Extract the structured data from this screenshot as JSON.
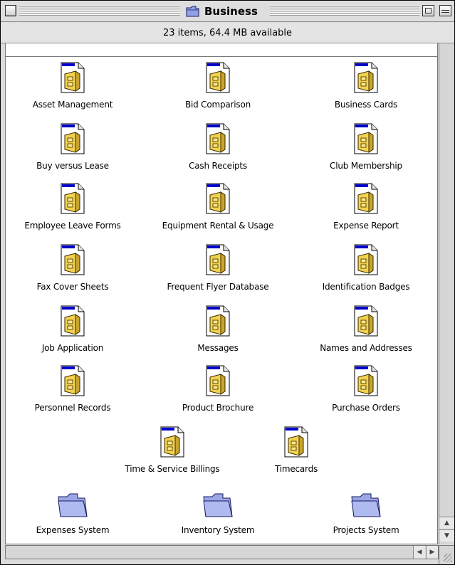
{
  "window": {
    "title": "Business",
    "status_text": "23 items, 64.4 MB available"
  },
  "colors": {
    "file_tab": "#0000cc",
    "file_body": "#f2d24e",
    "folder": "#9aa7e6"
  },
  "items": [
    {
      "label": "Asset Management",
      "kind": "document",
      "icon": "filemaker-doc-icon"
    },
    {
      "label": "Bid Comparison",
      "kind": "document",
      "icon": "filemaker-doc-icon"
    },
    {
      "label": "Business Cards",
      "kind": "document",
      "icon": "filemaker-doc-icon"
    },
    {
      "label": "Buy versus Lease",
      "kind": "document",
      "icon": "filemaker-doc-icon"
    },
    {
      "label": "Cash Receipts",
      "kind": "document",
      "icon": "filemaker-doc-icon"
    },
    {
      "label": "Club Membership",
      "kind": "document",
      "icon": "filemaker-doc-icon"
    },
    {
      "label": "Employee Leave Forms",
      "kind": "document",
      "icon": "filemaker-doc-icon"
    },
    {
      "label": "Equipment Rental & Usage",
      "kind": "document",
      "icon": "filemaker-doc-icon"
    },
    {
      "label": "Expense Report",
      "kind": "document",
      "icon": "filemaker-doc-icon"
    },
    {
      "label": "Fax Cover Sheets",
      "kind": "document",
      "icon": "filemaker-doc-icon"
    },
    {
      "label": "Frequent Flyer Database",
      "kind": "document",
      "icon": "filemaker-doc-icon"
    },
    {
      "label": "Identification Badges",
      "kind": "document",
      "icon": "filemaker-doc-icon"
    },
    {
      "label": "Job Application",
      "kind": "document",
      "icon": "filemaker-doc-icon"
    },
    {
      "label": "Messages",
      "kind": "document",
      "icon": "filemaker-doc-icon"
    },
    {
      "label": "Names and Addresses",
      "kind": "document",
      "icon": "filemaker-doc-icon"
    },
    {
      "label": "Personnel Records",
      "kind": "document",
      "icon": "filemaker-doc-icon"
    },
    {
      "label": "Product Brochure",
      "kind": "document",
      "icon": "filemaker-doc-icon"
    },
    {
      "label": "Purchase Orders",
      "kind": "document",
      "icon": "filemaker-doc-icon"
    },
    {
      "label": "Time & Service Billings",
      "kind": "document",
      "icon": "filemaker-doc-icon"
    },
    {
      "label": "Timecards",
      "kind": "document",
      "icon": "filemaker-doc-icon"
    },
    {
      "label": "Expenses System",
      "kind": "folder",
      "icon": "folder-icon"
    },
    {
      "label": "Inventory System",
      "kind": "folder",
      "icon": "folder-icon"
    },
    {
      "label": "Projects System",
      "kind": "folder",
      "icon": "folder-icon"
    }
  ],
  "scrollbar": {
    "up_arrow": "▲",
    "down_arrow": "▼",
    "left_arrow": "◀",
    "right_arrow": "▶"
  }
}
